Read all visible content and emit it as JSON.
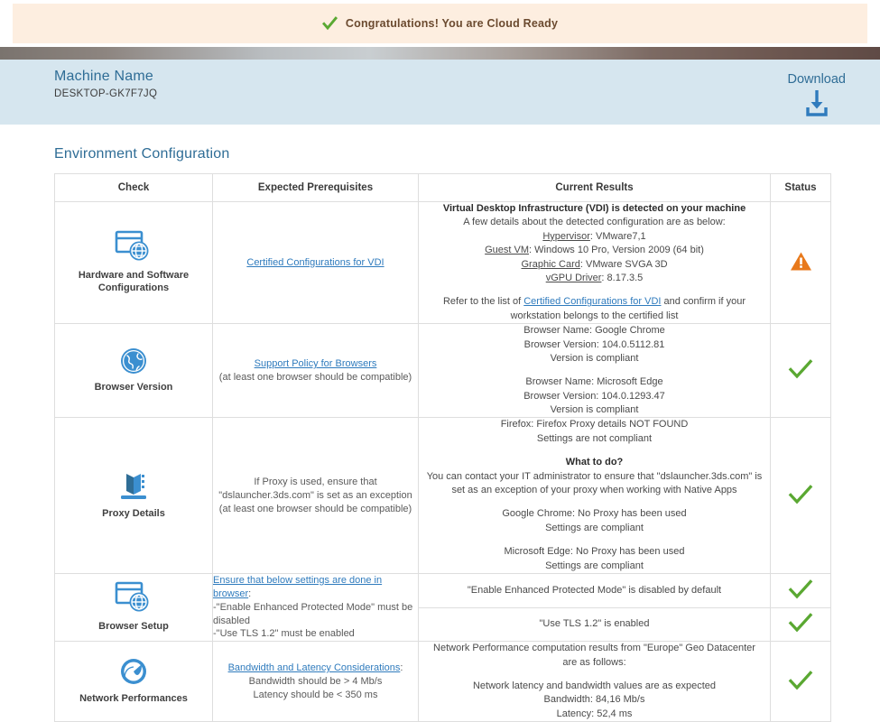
{
  "banner": {
    "icon": "check-green-icon",
    "text": "Congratulations! You are Cloud Ready"
  },
  "info_bar": {
    "machine_name_label": "Machine Name",
    "machine_name_value": "DESKTOP-GK7F7JQ",
    "download_label": "Download",
    "download_icon": "download-arrow-icon"
  },
  "section": {
    "title": "Environment Configuration"
  },
  "table": {
    "headers": {
      "check": "Check",
      "prereq": "Expected Prerequisites",
      "results": "Current Results",
      "status": "Status"
    },
    "rows": [
      {
        "icon": "vdi-monitor-globe-icon",
        "check": "Hardware and Software Configurations",
        "prereq_link": "Certified Configurations for VDI",
        "results": {
          "heading": "Virtual Desktop Infrastructure (VDI) is detected on your machine",
          "subheading": "A few details about the detected configuration are as below:",
          "details": [
            {
              "label": "Hypervisor",
              "value": "VMware7,1"
            },
            {
              "label": "Guest VM",
              "value": "Windows 10 Pro, Version 2009 (64 bit)"
            },
            {
              "label": "Graphic Card",
              "value": "VMware SVGA 3D"
            },
            {
              "label": "vGPU Driver",
              "value": "8.17.3.5"
            }
          ],
          "footer_pre": "Refer to the list of ",
          "footer_link": "Certified Configurations for VDI",
          "footer_post": " and confirm if your workstation belongs to the certified list"
        },
        "status": "warning"
      },
      {
        "icon": "globe-icon",
        "check": "Browser Version",
        "prereq_link": "Support Policy for Browsers",
        "prereq_note": "(at least one browser should be compatible)",
        "results_lines": [
          "Browser Name: Google Chrome",
          "Browser Version: 104.0.5112.81",
          "Version is compliant",
          "",
          "Browser Name: Microsoft Edge",
          "Browser Version: 104.0.1293.47",
          "Version is compliant"
        ],
        "status": "ok"
      },
      {
        "icon": "proxy-server-icon",
        "check": "Proxy Details",
        "prereq_lines": [
          "If Proxy is used, ensure that",
          "\"dslauncher.3ds.com\" is set as an exception",
          "(at least one browser should be compatible)"
        ],
        "results": {
          "firefox_line1": "Firefox: Firefox Proxy details NOT FOUND",
          "firefox_line2": "Settings are not compliant",
          "what_heading": "What to do?",
          "what_body": "You can contact your IT administrator to ensure that \"dslauncher.3ds.com\" is set as an exception of your proxy when working with Native Apps",
          "chrome_line1": "Google Chrome: No Proxy has been used",
          "chrome_line2": "Settings are compliant",
          "edge_line1": "Microsoft Edge: No Proxy has been used",
          "edge_line2": "Settings are compliant"
        },
        "status": "ok"
      },
      {
        "icon": "browser-setup-icon",
        "check": "Browser Setup",
        "prereq_link": "Ensure that below settings are done in browser",
        "prereq_colon": ":",
        "prereq_bullets": [
          "-\"Enable Enhanced Protected Mode\" must be disabled",
          "-\"Use TLS 1.2\" must be enabled"
        ],
        "sub_rows": [
          {
            "result": "\"Enable Enhanced Protected Mode\" is disabled by default",
            "status": "ok"
          },
          {
            "result": "\"Use TLS 1.2\" is enabled",
            "status": "ok"
          }
        ]
      },
      {
        "icon": "speedometer-icon",
        "check": "Network Performances",
        "prereq_link": "Bandwidth and Latency Considerations",
        "prereq_colon": ":",
        "prereq_bullets": [
          "Bandwidth should be > 4 Mb/s",
          "Latency should be < 350 ms"
        ],
        "results_lines": [
          "Network Performance computation results from \"Europe\" Geo Datacenter",
          "are as follows:",
          "",
          "Network latency and bandwidth values are as expected",
          "Bandwidth: 84,16 Mb/s",
          "Latency: 52,4 ms"
        ],
        "status": "ok"
      }
    ]
  },
  "colors": {
    "accent_blue": "#2f7bbd",
    "title_blue": "#2f6d96",
    "info_bar_bg": "#d6e6ef",
    "banner_bg": "#fdeee0",
    "banner_text": "#6b4a2f",
    "status_ok": "#56ab2f",
    "status_warning": "#e8791c"
  }
}
